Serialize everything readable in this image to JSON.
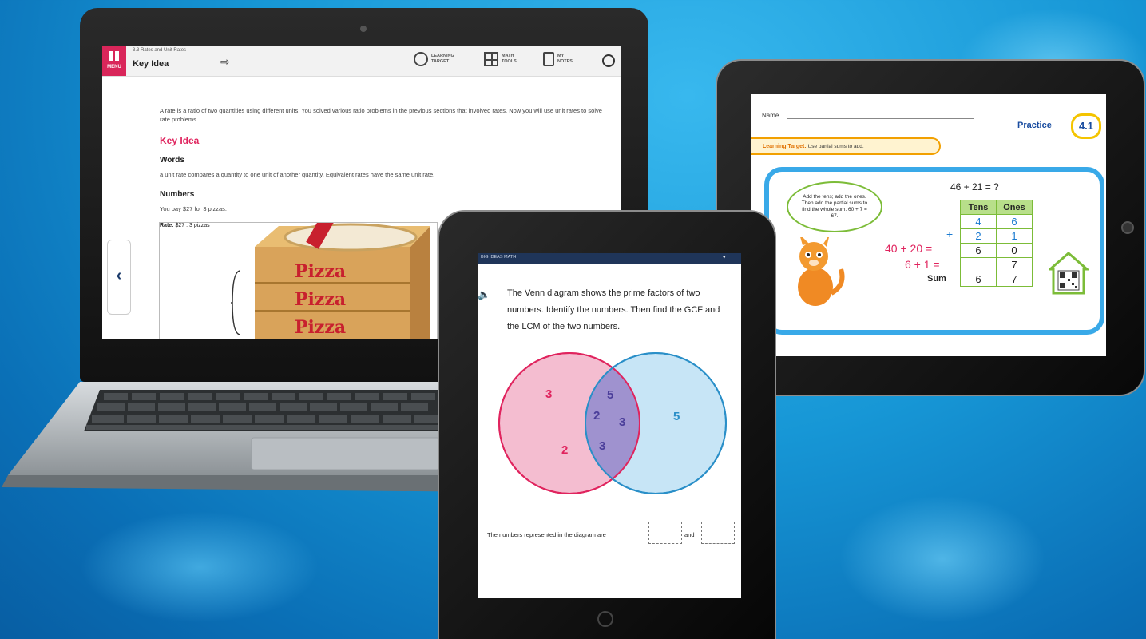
{
  "laptop": {
    "menu_label": "MENU",
    "section": "3.3 Rates and Unit Rates",
    "title": "Key Idea",
    "tools": [
      {
        "label_top": "LEARNING",
        "label_bottom": "TARGET"
      },
      {
        "label_top": "MATH",
        "label_bottom": "TOOLS"
      },
      {
        "label_top": "MY",
        "label_bottom": "NOTES"
      }
    ],
    "intro": "A rate is a ratio of two quantities using different units. You solved various ratio problems in the previous sections that involved rates. Now you will use unit rates to solve rate problems.",
    "key_idea": "Key Idea",
    "words_heading": "Words",
    "words_text": "a unit rate compares a quantity to one unit of another quantity. Equivalent rates have the same unit rate.",
    "numbers_heading": "Numbers",
    "numbers_text": "You pay $27 for 3 pizzas.",
    "rate_label": "Rate:",
    "rate_value": "$27 : 3 pizzas",
    "pizza_word": "Pizza",
    "prev_arrow": "‹"
  },
  "practice_tablet": {
    "name_label": "Name",
    "practice_label": "Practice",
    "badge": "4.1",
    "learning_target_label": "Learning Target:",
    "learning_target_text": "Use partial sums to add.",
    "cloud_text": "Add the tens; add the ones. Then add the partial sums to find the whole sum. 60 + 7 = 67.",
    "equation": "46 + 21 = ?",
    "table_headers": [
      "Tens",
      "Ones"
    ],
    "table_rows": [
      [
        "4",
        "6"
      ],
      [
        "2",
        "1"
      ],
      [
        "6",
        "0"
      ],
      [
        "",
        "7"
      ],
      [
        "6",
        "7"
      ]
    ],
    "plus_sign": "+",
    "partial_tens": "40 + 20 =",
    "partial_ones": "6 + 1 =",
    "sum_label": "Sum"
  },
  "venn_tablet": {
    "header_label": "BIG IDEAS MATH",
    "caret": "▾",
    "speaker_icon": "🔊",
    "question": "The Venn diagram shows the prime factors of two numbers. Identify the numbers. Then find the GCF and the LCM of the two numbers.",
    "left_only": [
      "3",
      "2"
    ],
    "shared": [
      "5",
      "2",
      "3",
      "3"
    ],
    "right_only": [
      "5"
    ],
    "answer_prompt": "The numbers represented in the diagram are",
    "and_label": "and",
    "colors": {
      "left": "#e0245e",
      "right": "#2a8fc8",
      "shared": "#4b3e9a"
    }
  }
}
